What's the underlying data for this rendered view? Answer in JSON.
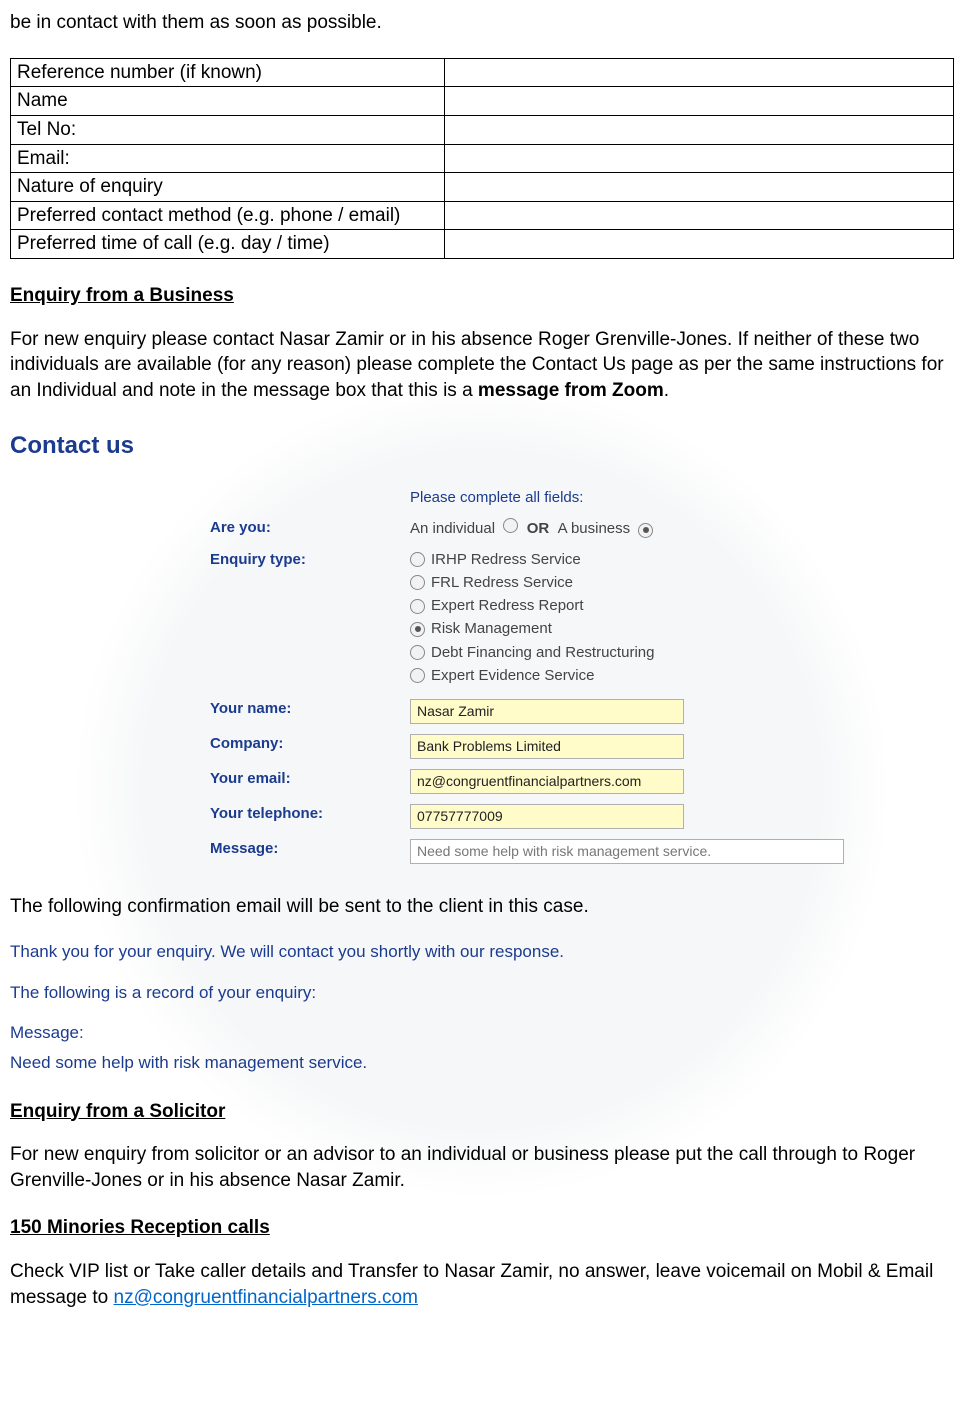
{
  "topLine": "be in contact with them as soon as possible.",
  "formRows": [
    "Reference number (if known)",
    "Name",
    "Tel No:",
    "Email:",
    "Nature of enquiry",
    "Preferred contact method (e.g. phone / email)",
    "Preferred time of call (e.g. day / time)"
  ],
  "sectionBusiness": {
    "heading": "Enquiry from a Business",
    "para_pre": "For new enquiry please contact Nasar Zamir or in his absence Roger Grenville-Jones.  If neither of these two individuals are available (for any reason) please complete the Contact Us page as per the same instructions for an Individual and note in the message box that this is a ",
    "para_bold": "message from Zoom",
    "para_post": "."
  },
  "contactForm": {
    "title": "Contact us",
    "intro": "Please complete all fields:",
    "areYouLabel": "Are you:",
    "areYou": {
      "individual": "An individual",
      "or": "OR",
      "business": "A business",
      "selected": "business"
    },
    "enquiryTypeLabel": "Enquiry type:",
    "enquiryTypes": [
      {
        "label": "IRHP Redress Service",
        "selected": false
      },
      {
        "label": "FRL Redress Service",
        "selected": false
      },
      {
        "label": "Expert Redress Report",
        "selected": false
      },
      {
        "label": "Risk Management",
        "selected": true
      },
      {
        "label": "Debt Financing and Restructuring",
        "selected": false
      },
      {
        "label": "Expert Evidence Service",
        "selected": false
      }
    ],
    "fields": {
      "nameLabel": "Your name:",
      "nameValue": "Nasar Zamir",
      "companyLabel": "Company:",
      "companyValue": "Bank Problems Limited",
      "emailLabel": "Your email:",
      "emailValue": "nz@congruentfinancialpartners.com",
      "telLabel": "Your telephone:",
      "telValue": "07757777009",
      "messageLabel": "Message:",
      "messageValue": "Need some help with risk management service."
    }
  },
  "confirmIntro": "The following confirmation email will be sent to the client in this case.",
  "confirmEmail": {
    "line1": "Thank you for your enquiry.  We will contact you shortly with our response.",
    "line2": "The following is a record of your enquiry:",
    "msgLabel": "Message:",
    "msgBody": "Need some help with risk management service."
  },
  "sectionSolicitor": {
    "heading": "Enquiry from a Solicitor",
    "para": "For new enquiry from solicitor or an advisor to an individual or business please put the call through to Roger Grenville-Jones or in his absence Nasar Zamir."
  },
  "sectionMinories": {
    "heading": "150 Minories Reception calls",
    "para_pre": "Check VIP list or Take caller details and Transfer to Nasar Zamir, no answer, leave voicemail on Mobil & Email message to ",
    "link": "nz@congruentfinancialpartners.com"
  }
}
